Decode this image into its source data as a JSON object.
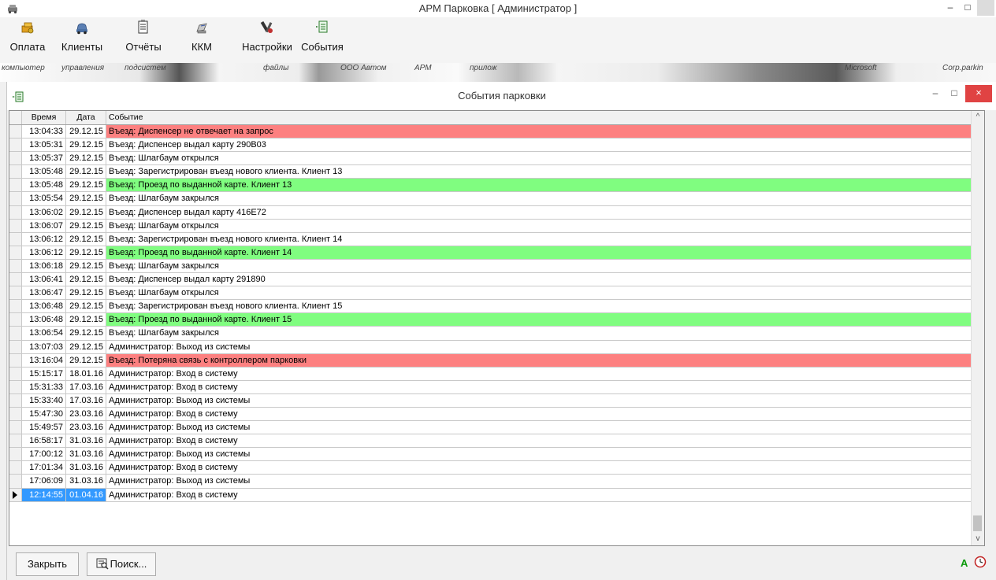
{
  "window": {
    "title": "АРМ Парковка [ Администратор ]",
    "minimize": "–",
    "maximize": "□"
  },
  "toolbar": {
    "items": [
      {
        "label": "Оплата",
        "icon": "payment-icon"
      },
      {
        "label": "Клиенты",
        "icon": "car-icon"
      },
      {
        "label": "Отчёты",
        "icon": "report-icon"
      },
      {
        "label": "ККМ",
        "icon": "cash-register-icon"
      },
      {
        "label": "Настройки",
        "icon": "settings-icon"
      },
      {
        "label": "События",
        "icon": "events-icon"
      }
    ]
  },
  "banner": {
    "texts": [
      "компьютер",
      "управления",
      "подсистем",
      "файлы",
      "ООО Автом",
      "АРМ",
      "прилож",
      "Microsoft",
      "Corp.parkin"
    ]
  },
  "child_window": {
    "title": "События парковки",
    "minimize": "–",
    "maximize": "□",
    "close": "×"
  },
  "table": {
    "columns": [
      "Время",
      "Дата",
      "Событие"
    ],
    "rows": [
      {
        "time": "13:04:33",
        "date": "29.12.15",
        "event": "Въезд: Диспенсер не отвечает на запрос",
        "status": "error"
      },
      {
        "time": "13:05:31",
        "date": "29.12.15",
        "event": "Въезд: Диспенсер выдал карту 290B03",
        "status": "normal"
      },
      {
        "time": "13:05:37",
        "date": "29.12.15",
        "event": "Въезд: Шлагбаум открылся",
        "status": "normal"
      },
      {
        "time": "13:05:48",
        "date": "29.12.15",
        "event": "Въезд: Зарегистрирован въезд нового клиента. Клиент 13",
        "status": "normal"
      },
      {
        "time": "13:05:48",
        "date": "29.12.15",
        "event": "Въезд: Проезд по выданной карте. Клиент 13",
        "status": "success"
      },
      {
        "time": "13:05:54",
        "date": "29.12.15",
        "event": "Въезд: Шлагбаум закрылся",
        "status": "normal"
      },
      {
        "time": "13:06:02",
        "date": "29.12.15",
        "event": "Въезд: Диспенсер выдал карту 416E72",
        "status": "normal"
      },
      {
        "time": "13:06:07",
        "date": "29.12.15",
        "event": "Въезд: Шлагбаум открылся",
        "status": "normal"
      },
      {
        "time": "13:06:12",
        "date": "29.12.15",
        "event": "Въезд: Зарегистрирован въезд нового клиента. Клиент 14",
        "status": "normal"
      },
      {
        "time": "13:06:12",
        "date": "29.12.15",
        "event": "Въезд: Проезд по выданной карте. Клиент 14",
        "status": "success"
      },
      {
        "time": "13:06:18",
        "date": "29.12.15",
        "event": "Въезд: Шлагбаум закрылся",
        "status": "normal"
      },
      {
        "time": "13:06:41",
        "date": "29.12.15",
        "event": "Въезд: Диспенсер выдал карту 291890",
        "status": "normal"
      },
      {
        "time": "13:06:47",
        "date": "29.12.15",
        "event": "Въезд: Шлагбаум открылся",
        "status": "normal"
      },
      {
        "time": "13:06:48",
        "date": "29.12.15",
        "event": "Въезд: Зарегистрирован въезд нового клиента. Клиент 15",
        "status": "normal"
      },
      {
        "time": "13:06:48",
        "date": "29.12.15",
        "event": "Въезд: Проезд по выданной карте. Клиент 15",
        "status": "success"
      },
      {
        "time": "13:06:54",
        "date": "29.12.15",
        "event": "Въезд: Шлагбаум закрылся",
        "status": "normal"
      },
      {
        "time": "13:07:03",
        "date": "29.12.15",
        "event": "Администратор: Выход из системы",
        "status": "normal"
      },
      {
        "time": "13:16:04",
        "date": "29.12.15",
        "event": "Въезд: Потеряна связь с контроллером парковки",
        "status": "error"
      },
      {
        "time": "15:15:17",
        "date": "18.01.16",
        "event": "Администратор: Вход в систему",
        "status": "normal"
      },
      {
        "time": "15:31:33",
        "date": "17.03.16",
        "event": "Администратор: Вход в систему",
        "status": "normal"
      },
      {
        "time": "15:33:40",
        "date": "17.03.16",
        "event": "Администратор: Выход из системы",
        "status": "normal"
      },
      {
        "time": "15:47:30",
        "date": "23.03.16",
        "event": "Администратор: Вход в систему",
        "status": "normal"
      },
      {
        "time": "15:49:57",
        "date": "23.03.16",
        "event": "Администратор: Выход из системы",
        "status": "normal"
      },
      {
        "time": "16:58:17",
        "date": "31.03.16",
        "event": "Администратор: Вход в систему",
        "status": "normal"
      },
      {
        "time": "17:00:12",
        "date": "31.03.16",
        "event": "Администратор: Выход из системы",
        "status": "normal"
      },
      {
        "time": "17:01:34",
        "date": "31.03.16",
        "event": "Администратор: Вход в систему",
        "status": "normal"
      },
      {
        "time": "17:06:09",
        "date": "31.03.16",
        "event": "Администратор: Выход из системы",
        "status": "normal"
      },
      {
        "time": "12:14:55",
        "date": "01.04.16",
        "event": "Администратор: Вход в систему",
        "status": "normal",
        "selected": true
      }
    ]
  },
  "colors": {
    "error_row": "#fd8080",
    "success_row": "#80fd80",
    "selection": "#3399ff",
    "close_button": "#e04343"
  },
  "buttons": {
    "close_label": "Закрыть",
    "search_label": "Поиск..."
  },
  "status": {
    "indicator": "A",
    "clock_icon": "clock-icon"
  }
}
